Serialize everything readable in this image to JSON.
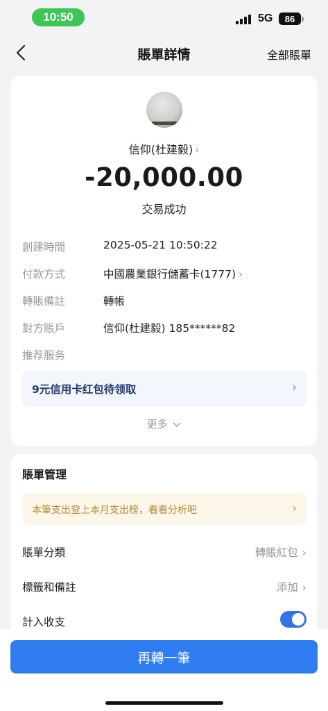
{
  "status_bar": {
    "time": "10:50",
    "network": "5G",
    "battery": "86"
  },
  "nav": {
    "title": "賬單詳情",
    "right_action": "全部賬單"
  },
  "detail": {
    "payee": "信仰(杜建毅)",
    "amount": "-20,000.00",
    "status": "交易成功",
    "rows": [
      {
        "label": "創建時間",
        "value": "2025-05-21 10:50:22"
      },
      {
        "label": "付款方式",
        "value": "中國農業銀行儲蓄卡(1777)"
      },
      {
        "label": "轉賬備註",
        "value": "轉帳"
      },
      {
        "label": "對方賬戶",
        "value": "信仰(杜建毅) 185******82"
      },
      {
        "label": "推荐服务",
        "value": ""
      }
    ],
    "promo": "9元信用卡红包待领取",
    "more": "更多"
  },
  "manage": {
    "title": "賬單管理",
    "tip": "本筆支出登上本月支出榜，看看分析吧",
    "category_label": "賬單分類",
    "category_value": "轉賬紅包",
    "tags_label": "標籤和備註",
    "tags_value": "添加",
    "count_label": "計入收支",
    "count_enabled": true
  },
  "primary_button": "再轉一筆",
  "colors": {
    "accent": "#2f7cf0",
    "status_time": "#3bc655",
    "toggle_on": "#2f75e8"
  },
  "icons": [
    "back-icon",
    "chevron-right-icon",
    "chevron-down-icon",
    "signal-icon",
    "battery-icon"
  ]
}
